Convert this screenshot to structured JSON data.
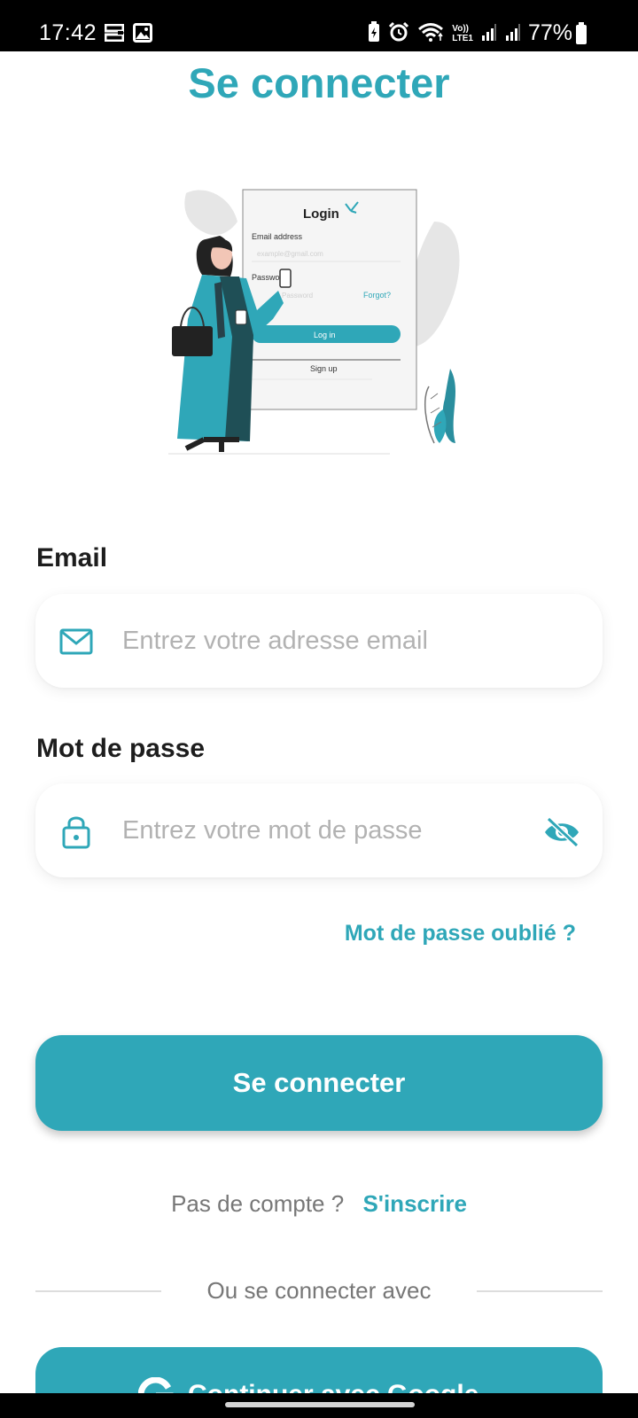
{
  "status_bar": {
    "time": "17:42",
    "battery": "77%",
    "icons_left": [
      "app-notification-icon",
      "image-icon"
    ],
    "icons_right": [
      "battery-saver-icon",
      "alarm-icon",
      "wifi-icon",
      "volte-icon",
      "signal-icon",
      "signal-icon"
    ],
    "volte_text": "Vo))",
    "lte_text": "LTE1"
  },
  "page": {
    "title": "Se connecter"
  },
  "illustration": {
    "card_title": "Login",
    "email_label": "Email address",
    "email_placeholder": "example@gmail.com",
    "password_label": "Password",
    "password_placeholder": "Password",
    "forgot_label": "Forgot?",
    "login_button": "Log in",
    "signup_label": "Sign up"
  },
  "form": {
    "email_label": "Email",
    "email_placeholder": "Entrez votre adresse email",
    "email_icon": "mail-icon",
    "password_label": "Mot de passe",
    "password_placeholder": "Entrez votre mot de passe",
    "password_icon": "lock-icon",
    "visibility_icon": "eye-off-icon",
    "forgot_password": "Mot de passe oublié ?",
    "submit_label": "Se connecter"
  },
  "signup": {
    "prompt": "Pas de compte ?",
    "link": "S'inscrire"
  },
  "social": {
    "divider_text": "Ou se connecter avec",
    "google_label": "Continuer avec Google",
    "google_icon": "google-icon"
  },
  "colors": {
    "accent": "#2fa7b8",
    "label": "#1d1d1d",
    "muted": "#777777",
    "placeholder": "#b2b2b2"
  }
}
